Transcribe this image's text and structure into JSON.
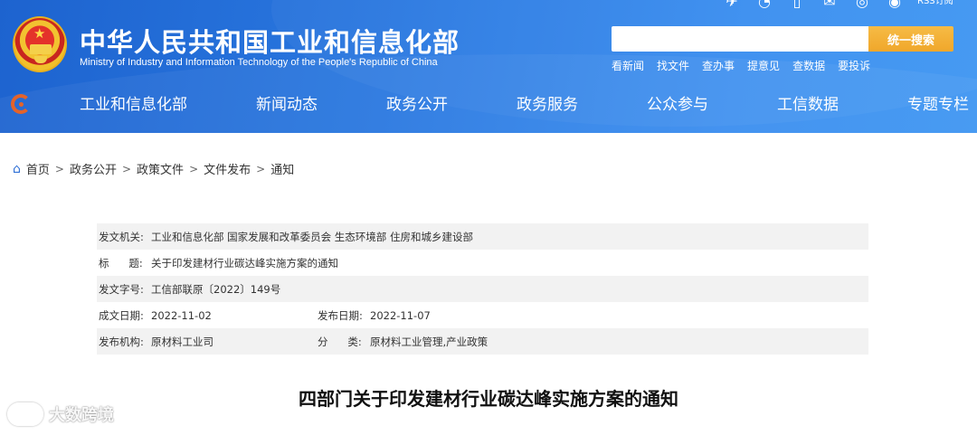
{
  "header": {
    "title": "中华人民共和国工业和信息化部",
    "subtitle": "Ministry of Industry and Information Technology of the People's Republic of China",
    "top_icons": [
      "mobile-icon",
      "weibo-icon",
      "phone-icon",
      "mail-icon",
      "wechat-icon",
      "eye-icon"
    ],
    "rss_label": "RSS订阅",
    "search": {
      "placeholder": "",
      "button_label": "统一搜索"
    },
    "quick_links": [
      "看新闻",
      "找文件",
      "查办事",
      "提意见",
      "查数据",
      "要投诉"
    ]
  },
  "nav": {
    "items": [
      "工业和信息化部",
      "新闻动态",
      "政务公开",
      "政务服务",
      "公众参与",
      "工信数据",
      "专题专栏"
    ]
  },
  "breadcrumb": [
    "首页",
    "政务公开",
    "政策文件",
    "文件发布",
    "通知"
  ],
  "meta": {
    "issuer_label": "发文机关:",
    "issuer": "工业和信息化部 国家发展和改革委员会 生态环境部 住房和城乡建设部",
    "title_label": "标      题:",
    "title": "关于印发建材行业碳达峰实施方案的通知",
    "doc_no_label": "发文字号:",
    "doc_no": "工信部联原〔2022〕149号",
    "created_label": "成文日期:",
    "created": "2022-11-02",
    "published_label": "发布日期:",
    "published": "2022-11-07",
    "org_label": "发布机构:",
    "org": "原材料工业司",
    "category_label": "分      类:",
    "category": "原材料工业管理,产业政策"
  },
  "document_title": "四部门关于印发建材行业碳达峰实施方案的通知",
  "watermark": "大数跨境",
  "colors": {
    "header_blue": "#2a78e0",
    "search_button": "#f0a72b",
    "home_icon": "#2e6fd6"
  }
}
